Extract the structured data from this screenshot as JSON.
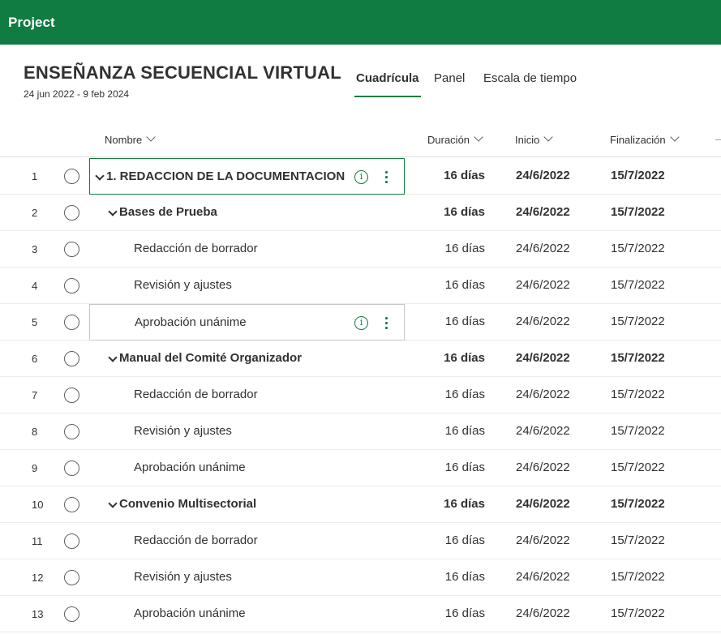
{
  "app": {
    "title": "Project"
  },
  "project": {
    "name": "ENSEÑANZA SECUENCIAL VIRTUAL",
    "dates": "24 jun 2022 - 9 feb 2024"
  },
  "tabs": [
    {
      "label": "Cuadrícula",
      "active": true
    },
    {
      "label": "Panel",
      "active": false
    },
    {
      "label": "Escala de tiempo",
      "active": false
    }
  ],
  "columns": {
    "name": "Nombre",
    "duration": "Duración",
    "start": "Inicio",
    "finish": "Finalización"
  },
  "colors": {
    "brand": "#107c41",
    "text": "#323130"
  },
  "tasks": [
    {
      "num": "1",
      "name": "1. REDACCION DE LA DOCUMENTACION",
      "level": 0,
      "summary": true,
      "duration": "16 días",
      "start": "24/6/2022",
      "finish": "15/7/2022"
    },
    {
      "num": "2",
      "name": "Bases de Prueba",
      "level": 1,
      "summary": true,
      "duration": "16 días",
      "start": "24/6/2022",
      "finish": "15/7/2022"
    },
    {
      "num": "3",
      "name": "Redacción de borrador",
      "level": 2,
      "summary": false,
      "duration": "16 días",
      "start": "24/6/2022",
      "finish": "15/7/2022"
    },
    {
      "num": "4",
      "name": "Revisión y ajustes",
      "level": 2,
      "summary": false,
      "duration": "16 días",
      "start": "24/6/2022",
      "finish": "15/7/2022"
    },
    {
      "num": "5",
      "name": "Aprobación unánime",
      "level": 2,
      "summary": false,
      "duration": "16 días",
      "start": "24/6/2022",
      "finish": "15/7/2022"
    },
    {
      "num": "6",
      "name": "Manual del Comité Organizador",
      "level": 1,
      "summary": true,
      "duration": "16 días",
      "start": "24/6/2022",
      "finish": "15/7/2022"
    },
    {
      "num": "7",
      "name": "Redacción de borrador",
      "level": 2,
      "summary": false,
      "duration": "16 días",
      "start": "24/6/2022",
      "finish": "15/7/2022"
    },
    {
      "num": "8",
      "name": "Revisión y ajustes",
      "level": 2,
      "summary": false,
      "duration": "16 días",
      "start": "24/6/2022",
      "finish": "15/7/2022"
    },
    {
      "num": "9",
      "name": "Aprobación unánime",
      "level": 2,
      "summary": false,
      "duration": "16 días",
      "start": "24/6/2022",
      "finish": "15/7/2022"
    },
    {
      "num": "10",
      "name": "Convenio Multisectorial",
      "level": 1,
      "summary": true,
      "duration": "16 días",
      "start": "24/6/2022",
      "finish": "15/7/2022"
    },
    {
      "num": "11",
      "name": "Redacción de borrador",
      "level": 2,
      "summary": false,
      "duration": "16 días",
      "start": "24/6/2022",
      "finish": "15/7/2022"
    },
    {
      "num": "12",
      "name": "Revisión y ajustes",
      "level": 2,
      "summary": false,
      "duration": "16 días",
      "start": "24/6/2022",
      "finish": "15/7/2022"
    },
    {
      "num": "13",
      "name": "Aprobación unánime",
      "level": 2,
      "summary": false,
      "duration": "16 días",
      "start": "24/6/2022",
      "finish": "15/7/2022"
    }
  ]
}
